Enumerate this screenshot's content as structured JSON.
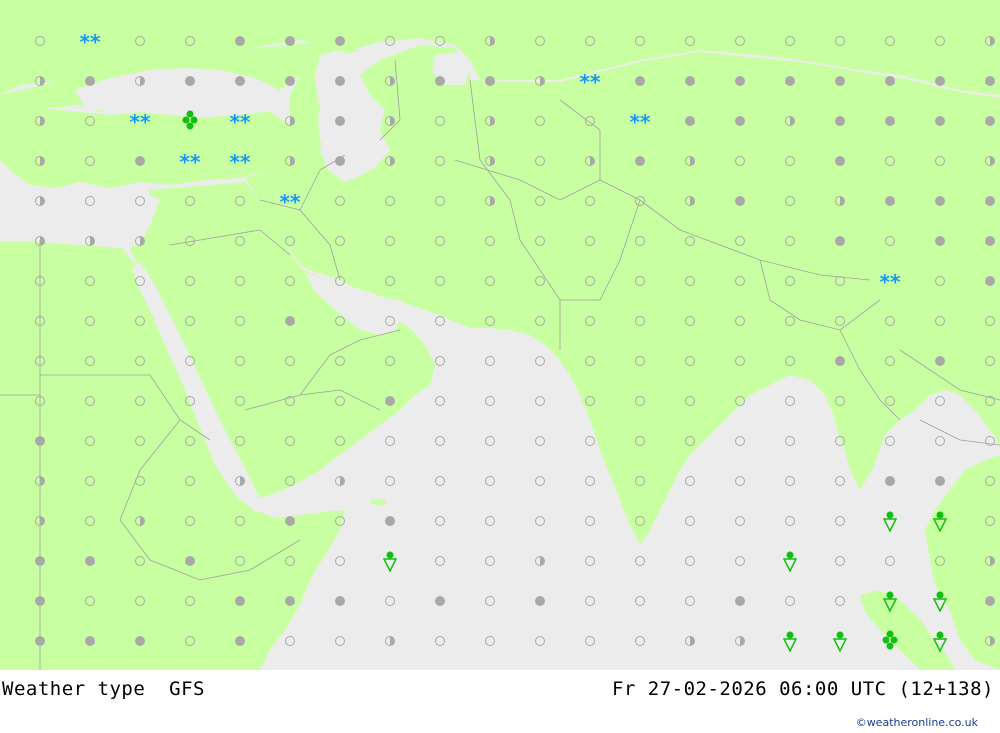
{
  "footer": {
    "title": "Weather type  GFS",
    "datetime": "Fr 27-02-2026 06:00 UTC (12+138)",
    "credit": "©weatheronline.co.uk"
  },
  "colors": {
    "land": "#c8ffa0",
    "sea": "#ececec",
    "border": "#a0a0a0",
    "dot": "#a8a8a8",
    "snow": "#1496ff",
    "rain": "#10c010"
  },
  "icon_names": {
    "0": "clear-icon",
    "1": "partly-cloudy-icon",
    "2": "cloudy-icon",
    "3": "snow-icon",
    "4": "shower-icon",
    "5": "hail-icon"
  },
  "grid": {
    "columns": 20,
    "rows": [
      [
        0,
        0,
        0,
        0,
        2,
        2,
        2,
        0,
        0,
        1,
        0,
        0,
        0,
        0,
        0,
        0,
        0,
        0,
        0,
        1
      ],
      [
        1,
        2,
        1,
        2,
        2,
        2,
        2,
        1,
        2,
        2,
        1,
        1,
        2,
        2,
        2,
        2,
        2,
        2,
        2,
        2
      ],
      [
        1,
        0,
        2,
        1,
        1,
        1,
        2,
        1,
        0,
        1,
        0,
        0,
        0,
        2,
        2,
        1,
        2,
        2,
        2,
        2
      ],
      [
        1,
        0,
        2,
        1,
        1,
        1,
        2,
        1,
        0,
        1,
        0,
        1,
        2,
        1,
        0,
        0,
        2,
        0,
        0,
        1
      ],
      [
        1,
        0,
        0,
        0,
        0,
        0,
        0,
        0,
        0,
        1,
        0,
        0,
        0,
        1,
        2,
        0,
        1,
        2,
        2,
        2
      ],
      [
        1,
        1,
        1,
        0,
        0,
        0,
        0,
        0,
        0,
        0,
        0,
        0,
        0,
        0,
        0,
        0,
        2,
        0,
        2,
        2
      ],
      [
        0,
        0,
        0,
        0,
        0,
        0,
        0,
        0,
        0,
        0,
        0,
        0,
        0,
        0,
        0,
        0,
        0,
        0,
        0,
        2
      ],
      [
        0,
        0,
        0,
        0,
        0,
        2,
        0,
        0,
        0,
        0,
        0,
        0,
        0,
        0,
        0,
        0,
        0,
        0,
        0,
        0
      ],
      [
        0,
        0,
        0,
        0,
        0,
        0,
        0,
        0,
        0,
        0,
        0,
        0,
        0,
        0,
        0,
        0,
        2,
        0,
        2,
        0
      ],
      [
        0,
        0,
        0,
        0,
        0,
        0,
        0,
        2,
        0,
        0,
        0,
        0,
        0,
        0,
        0,
        0,
        0,
        0,
        0,
        0
      ],
      [
        2,
        0,
        0,
        0,
        0,
        0,
        0,
        0,
        0,
        0,
        0,
        0,
        0,
        0,
        0,
        0,
        0,
        0,
        0,
        0
      ],
      [
        1,
        0,
        0,
        0,
        1,
        0,
        1,
        0,
        0,
        0,
        0,
        0,
        0,
        0,
        0,
        0,
        0,
        2,
        2,
        0
      ],
      [
        1,
        0,
        1,
        0,
        0,
        2,
        0,
        2,
        0,
        0,
        0,
        0,
        0,
        0,
        0,
        0,
        0,
        0,
        0,
        0
      ],
      [
        2,
        2,
        0,
        2,
        0,
        0,
        0,
        0,
        0,
        0,
        1,
        0,
        0,
        0,
        0,
        0,
        0,
        0,
        0,
        1
      ],
      [
        2,
        0,
        0,
        0,
        2,
        2,
        2,
        0,
        2,
        0,
        2,
        0,
        0,
        0,
        2,
        0,
        0,
        2,
        2,
        2
      ],
      [
        2,
        2,
        2,
        0,
        2,
        0,
        0,
        1,
        0,
        0,
        0,
        0,
        0,
        1,
        1,
        1,
        0,
        2,
        0,
        1
      ],
      [
        2,
        2,
        1,
        2,
        2,
        1,
        2,
        1,
        2,
        1,
        1,
        0,
        0,
        2,
        0,
        0,
        2,
        2,
        0,
        0
      ]
    ],
    "symbols": [
      {
        "row": 0,
        "col": 1,
        "type": 3
      },
      {
        "row": 1,
        "col": 11,
        "type": 3
      },
      {
        "row": 2,
        "col": 2,
        "type": 3
      },
      {
        "row": 2,
        "col": 3,
        "type": 5
      },
      {
        "row": 2,
        "col": 4,
        "type": 3
      },
      {
        "row": 2,
        "col": 12,
        "type": 3
      },
      {
        "row": 3,
        "col": 3,
        "type": 3
      },
      {
        "row": 3,
        "col": 4,
        "type": 3
      },
      {
        "row": 4,
        "col": 5,
        "type": 3
      },
      {
        "row": 6,
        "col": 17,
        "type": 3
      },
      {
        "row": 12,
        "col": 17,
        "type": 4
      },
      {
        "row": 12,
        "col": 18,
        "type": 4
      },
      {
        "row": 13,
        "col": 7,
        "type": 4
      },
      {
        "row": 13,
        "col": 15,
        "type": 4
      },
      {
        "row": 14,
        "col": 17,
        "type": 4
      },
      {
        "row": 14,
        "col": 18,
        "type": 4
      },
      {
        "row": 15,
        "col": 15,
        "type": 4
      },
      {
        "row": 15,
        "col": 16,
        "type": 4
      },
      {
        "row": 15,
        "col": 17,
        "type": 5
      },
      {
        "row": 15,
        "col": 18,
        "type": 4
      }
    ]
  }
}
